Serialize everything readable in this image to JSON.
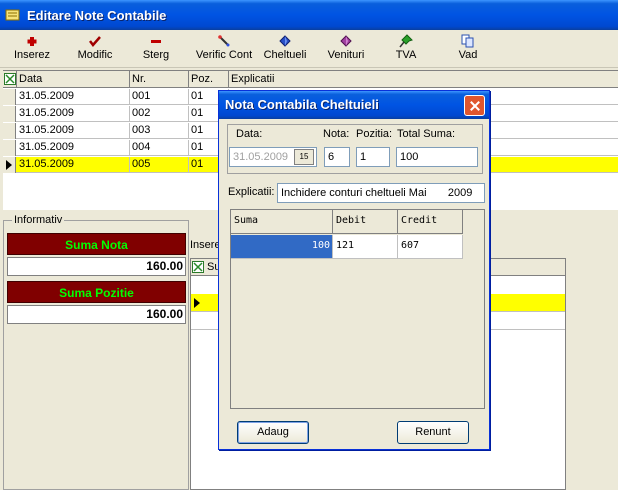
{
  "window": {
    "title": "Editare Note Contabile"
  },
  "toolbar": {
    "inserez": "Inserez",
    "modific": "Modific",
    "sterg": "Sterg",
    "verific": "Verific Cont",
    "cheltueli": "Cheltueli",
    "venituri": "Venituri",
    "tva": "TVA",
    "vad": "Vad"
  },
  "grid": {
    "headers": {
      "data": "Data",
      "nr": "Nr.",
      "poz": "Poz.",
      "explicatii": "Explicatii"
    },
    "rows": [
      {
        "data": "31.05.2009",
        "nr": "001",
        "poz": "01"
      },
      {
        "data": "31.05.2009",
        "nr": "002",
        "poz": "01"
      },
      {
        "data": "31.05.2009",
        "nr": "003",
        "poz": "01"
      },
      {
        "data": "31.05.2009",
        "nr": "004",
        "poz": "01"
      },
      {
        "data": "31.05.2009",
        "nr": "005",
        "poz": "01"
      }
    ]
  },
  "info": {
    "legend": "Informativ",
    "suma_nota_label": "Suma Nota",
    "suma_nota_value": "160.00",
    "suma_pozitie_label": "Suma Pozitie",
    "suma_pozitie_value": "160.00"
  },
  "lower": {
    "label_partial": "Insere",
    "header_partial": "Su"
  },
  "dialog": {
    "title": "Nota Contabila Cheltuieli",
    "data_label": "Data:",
    "data_value": "31.05.2009",
    "nota_label": "Nota:",
    "nota_value": "6",
    "pozitia_label": "Pozitia:",
    "pozitia_value": "1",
    "total_label": "Total Suma:",
    "total_value": "100",
    "calendar_glyph": "15",
    "explicatii_label": "Explicatii:",
    "explicatii_value": "Inchidere conturi cheltueli Mai       2009",
    "grid_headers": {
      "suma": "Suma",
      "debit": "Debit",
      "credit": "Credit"
    },
    "grid_row": {
      "suma": "100",
      "debit": "121",
      "credit": "607"
    },
    "adaug": "Adaug",
    "renunt": "Renunt"
  }
}
